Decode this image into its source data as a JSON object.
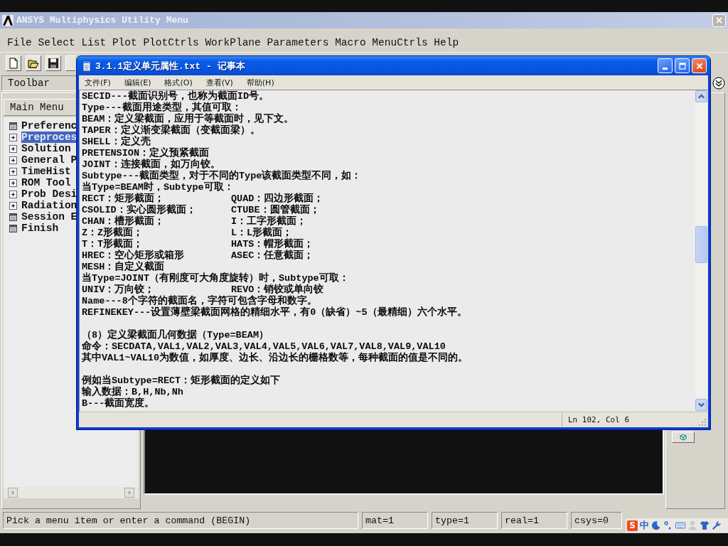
{
  "ansys": {
    "title": "ANSYS Multiphysics Utility Menu",
    "menu": [
      "File",
      "Select",
      "List",
      "Plot",
      "PlotCtrls",
      "WorkPlane",
      "Parameters",
      "Macro",
      "MenuCtrls",
      "Help"
    ],
    "toolbar_label": "Toolbar",
    "main_menu": {
      "title": "Main Menu",
      "items": [
        {
          "label": "Preferenc",
          "kind": "command",
          "selected": false
        },
        {
          "label": "Preproces",
          "kind": "group",
          "selected": true
        },
        {
          "label": "Solution",
          "kind": "group",
          "selected": false
        },
        {
          "label": "General P",
          "kind": "group",
          "selected": false
        },
        {
          "label": "TimeHist",
          "kind": "group",
          "selected": false
        },
        {
          "label": "ROM Tool",
          "kind": "group",
          "selected": false
        },
        {
          "label": "Prob Desi",
          "kind": "group",
          "selected": false
        },
        {
          "label": "Radiation",
          "kind": "group",
          "selected": false
        },
        {
          "label": "Session E",
          "kind": "command",
          "selected": false
        },
        {
          "label": "Finish",
          "kind": "command",
          "selected": false
        }
      ]
    },
    "status_bar": [
      "Pick a menu item or enter a command (BEGIN)",
      "mat=1",
      "type=1",
      "real=1",
      "csys=0"
    ]
  },
  "notepad": {
    "title": "3.1.1定义单元属性.txt - 记事本",
    "menu": [
      "文件(F)",
      "编辑(E)",
      "格式(O)",
      "查看(V)",
      "帮助(H)"
    ],
    "lines": [
      {
        "kind": "text",
        "text": "SECID---截面识别号，也称为截面ID号。"
      },
      {
        "kind": "text",
        "text": "Type---截面用途类型，其值可取："
      },
      {
        "kind": "text",
        "text": "BEAM：定义梁截面，应用于等截面时，见下文。"
      },
      {
        "kind": "text",
        "text": "TAPER：定义渐变梁截面（变截面梁）。"
      },
      {
        "kind": "text",
        "text": "SHELL：定义壳"
      },
      {
        "kind": "text",
        "text": "PRETENSION：定义预紧截面"
      },
      {
        "kind": "text",
        "text": "JOINT：连接截面，如万向铰。"
      },
      {
        "kind": "text",
        "text": "Subtype---截面类型，对于不同的Type该截面类型不同，如："
      },
      {
        "kind": "text",
        "text": "当Type=BEAM时，Subtype可取："
      },
      {
        "kind": "pair",
        "columns": [
          "RECT：矩形截面；",
          "QUAD：四边形截面；"
        ]
      },
      {
        "kind": "pair",
        "columns": [
          "CSOLID：实心圆形截面；",
          "CTUBE：圆管截面；"
        ]
      },
      {
        "kind": "pair",
        "columns": [
          "CHAN：槽形截面；",
          "I：工字形截面；"
        ]
      },
      {
        "kind": "pair",
        "columns": [
          "Z：Z形截面；",
          "L：L形截面；"
        ]
      },
      {
        "kind": "pair",
        "columns": [
          "T：T形截面；",
          "HATS：帽形截面；"
        ]
      },
      {
        "kind": "pair",
        "columns": [
          "HREC：空心矩形或箱形",
          "ASEC：任意截面；"
        ]
      },
      {
        "kind": "text",
        "text": "MESH：自定义截面"
      },
      {
        "kind": "text",
        "text": "当Type=JOINT（有刚度可大角度旋转）时，Subtype可取："
      },
      {
        "kind": "pair",
        "columns": [
          "UNIV：万向铰；",
          "REVO：销铰或单向铰"
        ]
      },
      {
        "kind": "text",
        "text": "Name---8个字符的截面名，字符可包含字母和数字。"
      },
      {
        "kind": "text",
        "text": "REFINEKEY---设置薄壁梁截面网格的精细水平，有0（缺省）~5（最精细）六个水平。"
      },
      {
        "kind": "blank"
      },
      {
        "kind": "text",
        "text": "（8）定义梁截面几何数据（Type=BEAM）"
      },
      {
        "kind": "text",
        "text": "命令：SECDATA,VAL1,VAL2,VAL3,VAL4,VAL5,VAL6,VAL7,VAL8,VAL9,VAL10"
      },
      {
        "kind": "text",
        "text": "其中VAL1~VAL10为数值，如厚度、边长、沿边长的栅格数等，每种截面的值是不同的。"
      },
      {
        "kind": "blank"
      },
      {
        "kind": "text",
        "text": "例如当Subtype=RECT：矩形截面的定义如下"
      },
      {
        "kind": "text",
        "text": "输入数据：B,H,Nb,Nh"
      },
      {
        "kind": "text",
        "text": "B---截面宽度。"
      }
    ],
    "status": "Ln 102, Col 6"
  },
  "ime": {
    "logo": "S",
    "mode": "中"
  }
}
